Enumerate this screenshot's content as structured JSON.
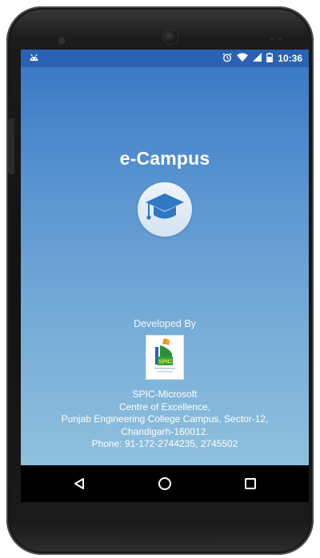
{
  "status_bar": {
    "time": "10:36",
    "icons": [
      "android-debug-icon",
      "alarm-icon",
      "wifi-icon",
      "signal-icon",
      "battery-icon"
    ]
  },
  "app": {
    "title": "e-Campus",
    "logo_icon": "graduation-cap-icon",
    "developed_by": "Developed By",
    "org_logo_text": "SPIC",
    "organization": {
      "line1": "SPIC-Microsoft",
      "line2": "Centre of Excellence,",
      "line3": "Punjab Engineering College Campus, Sector-12,",
      "line4": "Chandigarh-160012.",
      "line5": "Phone: 91-172-2744235, 2745502"
    }
  },
  "nav_bar": {
    "icons": [
      "back-icon",
      "home-icon",
      "recents-icon"
    ]
  },
  "colors": {
    "status_bar": "#2a62b4",
    "gradient_top": "#3b7ac6",
    "gradient_bottom": "#8fc0dd",
    "nav_bar": "#000000"
  }
}
